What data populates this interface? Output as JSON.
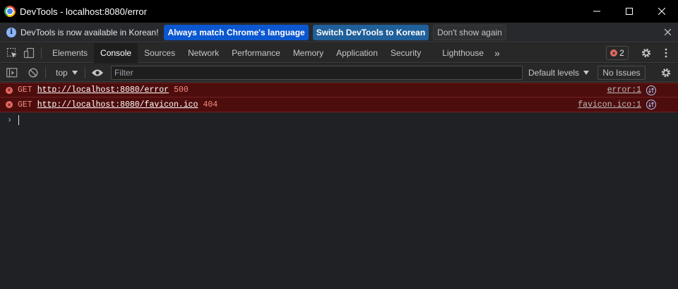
{
  "window": {
    "title": "DevTools - localhost:8080/error",
    "controls": [
      "minimize",
      "maximize",
      "close"
    ]
  },
  "infobar": {
    "message": "DevTools is now available in Korean!",
    "buttons": [
      "Always match Chrome's language",
      "Switch DevTools to Korean",
      "Don't show again"
    ]
  },
  "tabs": {
    "items": [
      "Elements",
      "Console",
      "Sources",
      "Network",
      "Performance",
      "Memory",
      "Application",
      "Security",
      "Lighthouse"
    ],
    "active": "Console",
    "more": "»",
    "error_count": "2"
  },
  "console_toolbar": {
    "context": "top",
    "filter_placeholder": "Filter",
    "levels": "Default levels",
    "issues": "No Issues"
  },
  "messages": [
    {
      "method": "GET",
      "url": "http://localhost:8080/error",
      "status": "500",
      "source": "error:1"
    },
    {
      "method": "GET",
      "url": "http://localhost:8080/favicon.ico",
      "status": "404",
      "source": "favicon.ico:1"
    }
  ],
  "prompt_symbol": "›",
  "colors": {
    "error_bg": "#4e0d0d",
    "error_text": "#f28b82",
    "button_blue": "#0b57d0",
    "link_blue": "#8ab4f8"
  }
}
